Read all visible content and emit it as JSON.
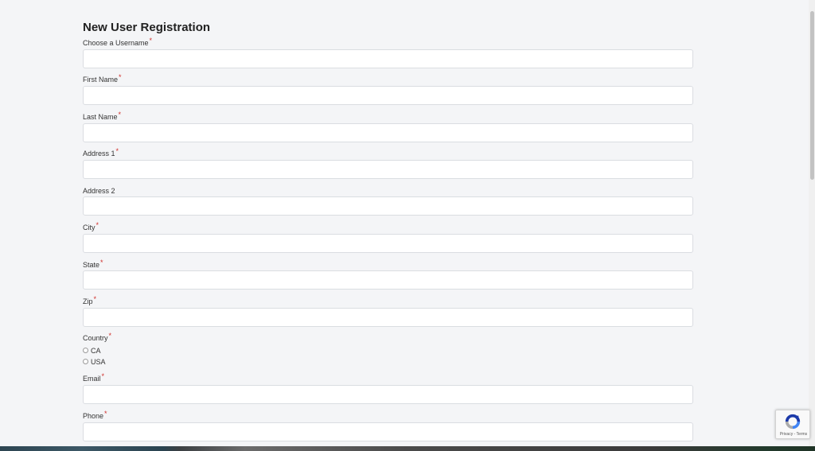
{
  "form": {
    "title": "New User Registration",
    "required_marker": "*",
    "fields": {
      "username": "Choose a Username",
      "first_name": "First Name",
      "last_name": "Last Name",
      "address1": "Address 1",
      "address2": "Address 2",
      "city": "City",
      "state": "State",
      "zip": "Zip",
      "country": "Country",
      "email": "Email",
      "phone": "Phone"
    },
    "country_options": [
      "CA",
      "USA"
    ]
  },
  "recaptcha": {
    "terms_text": "Privacy - Terms",
    "logo_icon": "recaptcha-icon"
  },
  "colors": {
    "required": "#d0312d",
    "page_background": "#f4f5f7"
  }
}
